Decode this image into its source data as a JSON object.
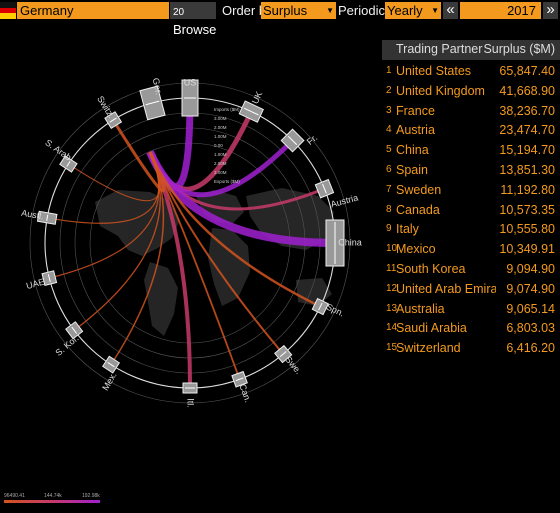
{
  "toolbar": {
    "country": "Germany",
    "browse_num": "20",
    "browse_label": "Browse",
    "order_by_label": "Order by",
    "order_by_value": "Surplus",
    "periodicity_label": "Periodicity",
    "periodicity_value": "Yearly",
    "prev": "«",
    "year": "2017",
    "next": "»"
  },
  "table": {
    "col_partner": "Trading Partner",
    "col_surplus": "Surplus ($M)",
    "rows": [
      {
        "rank": "1",
        "name": "United States",
        "value": "65,847.40"
      },
      {
        "rank": "2",
        "name": "United Kingdom",
        "value": "41,668.90"
      },
      {
        "rank": "3",
        "name": "France",
        "value": "38,236.70"
      },
      {
        "rank": "4",
        "name": "Austria",
        "value": "23,474.70"
      },
      {
        "rank": "5",
        "name": "China",
        "value": "15,194.70"
      },
      {
        "rank": "6",
        "name": "Spain",
        "value": "13,851.30"
      },
      {
        "rank": "7",
        "name": "Sweden",
        "value": "11,192.80"
      },
      {
        "rank": "8",
        "name": "Canada",
        "value": "10,573.35"
      },
      {
        "rank": "9",
        "name": "Italy",
        "value": "10,555.80"
      },
      {
        "rank": "10",
        "name": "Mexico",
        "value": "10,349.91"
      },
      {
        "rank": "11",
        "name": "South Korea",
        "value": "9,094.90"
      },
      {
        "rank": "12",
        "name": "United Arab Emirat",
        "value": "9,074.90"
      },
      {
        "rank": "13",
        "name": "Australia",
        "value": "9,065.14"
      },
      {
        "rank": "14",
        "name": "Saudi Arabia",
        "value": "6,803.03"
      },
      {
        "rank": "15",
        "name": "Switzerland",
        "value": "6,416.20"
      }
    ]
  },
  "chart": {
    "partners": [
      "US",
      "UK",
      "Fr.",
      "Austria",
      "China",
      "Spn.",
      "Swe.",
      "Can.",
      "Itl.",
      "Mex.",
      "S. Kor.",
      "UAE",
      "Austl.",
      "S. Arab.",
      "Switz.",
      "Ger."
    ],
    "scale_labels": [
      "Imports ($M)",
      "3.00M",
      "2.00M",
      "1.00M",
      "0.00",
      "1.00M",
      "2.00M",
      "3.00M",
      "Exports ($M)"
    ],
    "legend": [
      "96490.41",
      "144.74k",
      "192.98k"
    ],
    "colors": {
      "low": "#d2531e",
      "mid": "#c73a6a",
      "high": "#a020d0",
      "accent": "#f39a1e"
    }
  }
}
